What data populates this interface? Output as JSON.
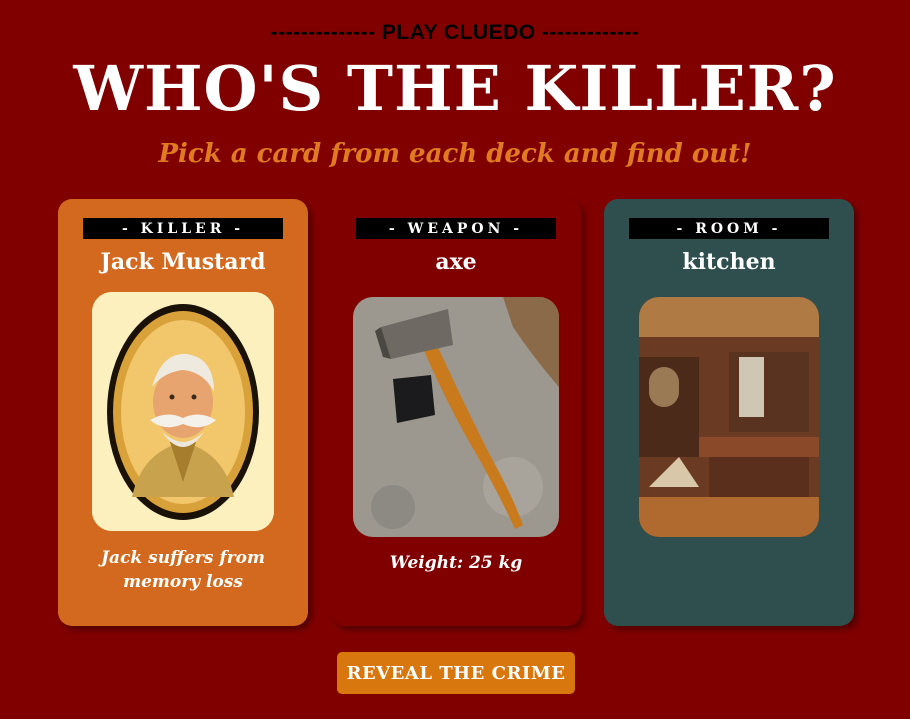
{
  "header": {
    "tagline": "-------------- PLAY CLUEDO -------------",
    "title": "WHO'S THE KILLER?",
    "subtitle": "Pick a card from each deck and find out!"
  },
  "cards": [
    {
      "label": "- KILLER -",
      "name": "Jack Mustard",
      "description": "Jack suffers from memory loss",
      "image": "portrait-of-jack-mustard",
      "color": "#d2691e"
    },
    {
      "label": "- WEAPON -",
      "name": "axe",
      "description": "Weight: 25 kg",
      "image": "axe-on-concrete",
      "color": "#800000"
    },
    {
      "label": "- ROOM -",
      "name": "kitchen",
      "description": "",
      "image": "wooden-kitchen-interior",
      "color": "#2f4f4f"
    }
  ],
  "actions": {
    "reveal_label": "REVEAL THE CRIME"
  },
  "colors": {
    "background": "#800000",
    "accent": "#e07b22",
    "button": "#d9770f"
  }
}
